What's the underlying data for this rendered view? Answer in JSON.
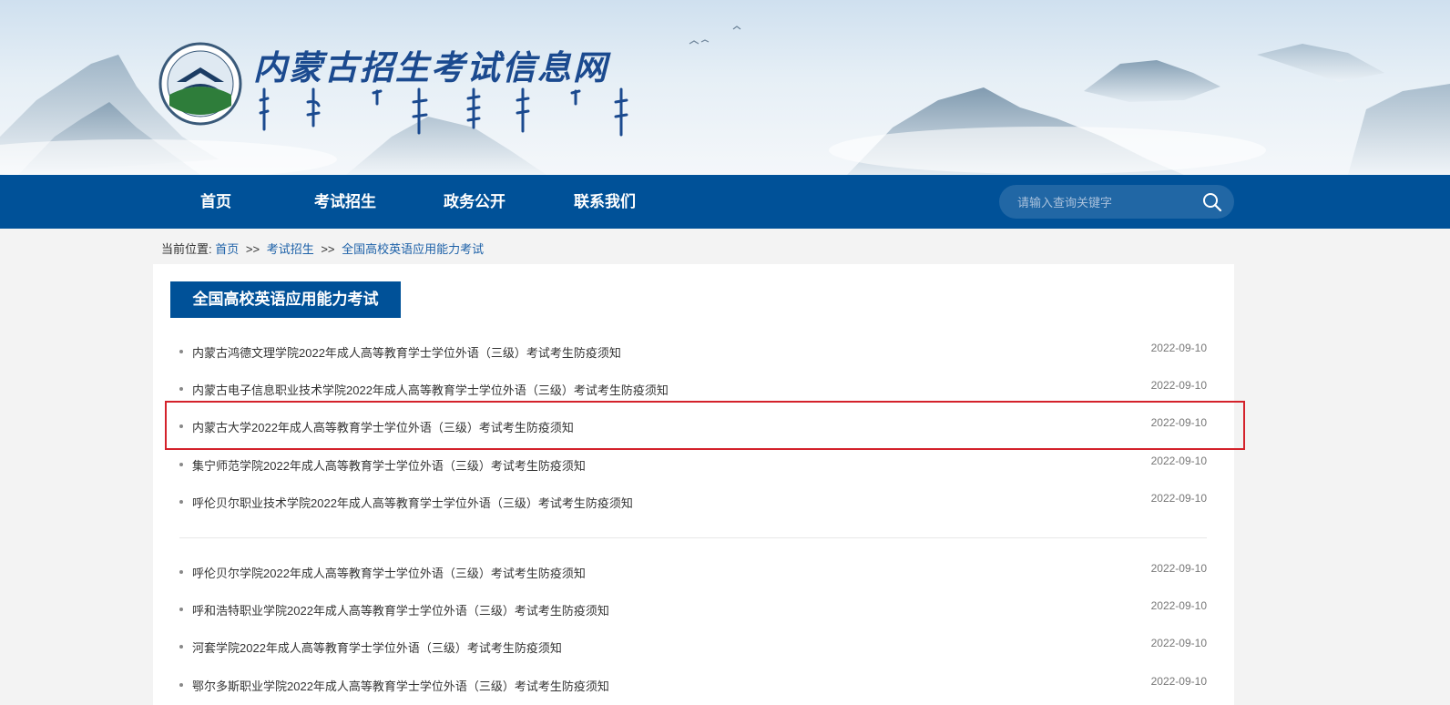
{
  "site": {
    "title": "内蒙古招生考试信息网",
    "mongolian_title": "ᠥᠪᠦᠷ ᠮᠣᠩᠭᠣᠯ ᠤᠨ ᠡᠯᠰᠡᠯᠲᠡ ᠶᠢᠨ ᠰᠢᠯᠭᠠᠯᠲᠠ ᠶᠢᠨ ᠮᠡᠳᠡᠭᠡᠯᠡᠯ ᠦᠨ ᠰᠦᠯᠵᠢᠶ᠎ᠡ"
  },
  "nav": {
    "items": [
      {
        "label": "首页"
      },
      {
        "label": "考试招生"
      },
      {
        "label": "政务公开"
      },
      {
        "label": "联系我们"
      }
    ],
    "search_placeholder": "请输入查询关键字"
  },
  "breadcrumb": {
    "prefix": "当前位置:",
    "links": [
      "首页",
      "考试招生",
      "全国高校英语应用能力考试"
    ],
    "separator": ">>"
  },
  "section": {
    "title": "全国高校英语应用能力考试"
  },
  "news": [
    {
      "title": "内蒙古鸿德文理学院2022年成人高等教育学士学位外语（三级）考试考生防疫须知",
      "date": "2022-09-10"
    },
    {
      "title": "内蒙古电子信息职业技术学院2022年成人高等教育学士学位外语（三级）考试考生防疫须知",
      "date": "2022-09-10"
    },
    {
      "title": "内蒙古大学2022年成人高等教育学士学位外语（三级）考试考生防疫须知",
      "date": "2022-09-10"
    },
    {
      "title": "集宁师范学院2022年成人高等教育学士学位外语（三级）考试考生防疫须知",
      "date": "2022-09-10"
    },
    {
      "title": "呼伦贝尔职业技术学院2022年成人高等教育学士学位外语（三级）考试考生防疫须知",
      "date": "2022-09-10"
    },
    {
      "title": "呼伦贝尔学院2022年成人高等教育学士学位外语（三级）考试考生防疫须知",
      "date": "2022-09-10"
    },
    {
      "title": "呼和浩特职业学院2022年成人高等教育学士学位外语（三级）考试考生防疫须知",
      "date": "2022-09-10"
    },
    {
      "title": "河套学院2022年成人高等教育学士学位外语（三级）考试考生防疫须知",
      "date": "2022-09-10"
    },
    {
      "title": "鄂尔多斯职业学院2022年成人高等教育学士学位外语（三级）考试考生防疫须知",
      "date": "2022-09-10"
    }
  ],
  "colors": {
    "brand_blue": "#005198",
    "highlight_red": "#d4222b",
    "link_blue": "#1d61a8"
  }
}
